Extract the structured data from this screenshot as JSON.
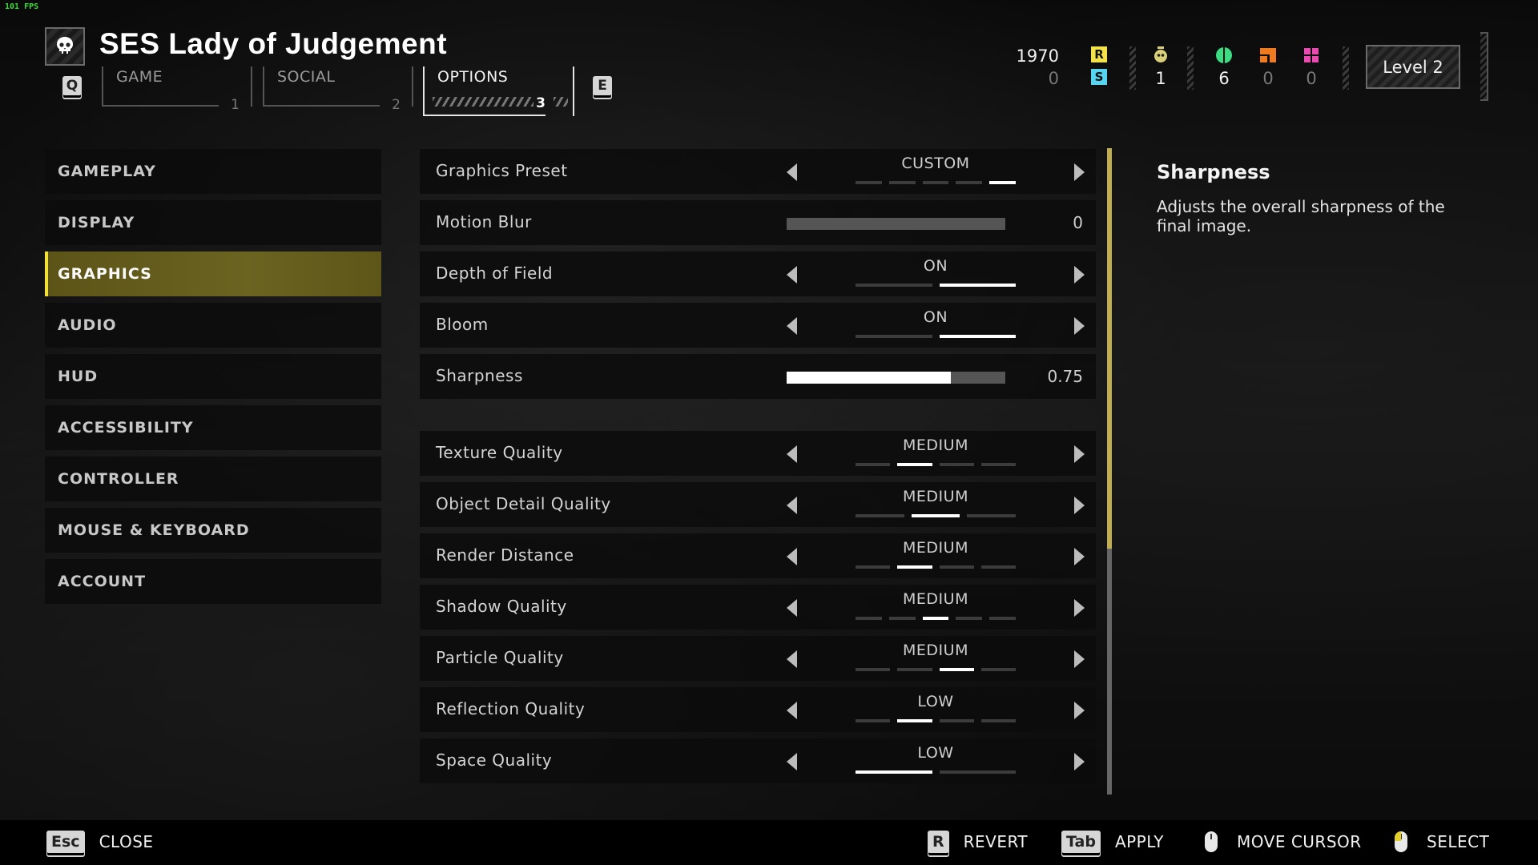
{
  "fps": "101 FPS",
  "header": {
    "title": "SES Lady of Judgement",
    "prev_key": "Q",
    "next_key": "E",
    "tabs": [
      {
        "label": "GAME",
        "number": "1",
        "active": false
      },
      {
        "label": "SOCIAL",
        "number": "2",
        "active": false
      },
      {
        "label": "OPTIONS",
        "number": "3",
        "active": true
      }
    ]
  },
  "currencies": {
    "requisition": {
      "value": "1970",
      "icon": "R",
      "color": "#f4e24a"
    },
    "super_credits": {
      "value": "0",
      "icon": "S",
      "color": "#56d4f0"
    }
  },
  "stats": [
    {
      "name": "medals",
      "value": "1",
      "color": "#d9cf7a"
    },
    {
      "name": "common-samples",
      "value": "6",
      "color": "#3ddc84"
    },
    {
      "name": "rare-samples",
      "value": "0",
      "color": "#f07a1e"
    },
    {
      "name": "super-samples",
      "value": "0",
      "color": "#e84ab0"
    }
  ],
  "level": "Level 2",
  "sidebar": {
    "items": [
      {
        "label": "GAMEPLAY",
        "active": false
      },
      {
        "label": "DISPLAY",
        "active": false
      },
      {
        "label": "GRAPHICS",
        "active": true
      },
      {
        "label": "AUDIO",
        "active": false
      },
      {
        "label": "HUD",
        "active": false
      },
      {
        "label": "ACCESSIBILITY",
        "active": false
      },
      {
        "label": "CONTROLLER",
        "active": false
      },
      {
        "label": "MOUSE & KEYBOARD",
        "active": false
      },
      {
        "label": "ACCOUNT",
        "active": false
      }
    ]
  },
  "settings": [
    {
      "label": "Graphics Preset",
      "type": "selector",
      "value": "CUSTOM",
      "steps": 5,
      "selected_index": 4,
      "selected_span": 1
    },
    {
      "label": "Motion Blur",
      "type": "slider",
      "value": "0",
      "fraction": 0
    },
    {
      "label": "Depth of Field",
      "type": "selector",
      "value": "ON",
      "steps": 2,
      "selected_index": 1,
      "selected_span": 1
    },
    {
      "label": "Bloom",
      "type": "selector",
      "value": "ON",
      "steps": 2,
      "selected_index": 1,
      "selected_span": 1
    },
    {
      "label": "Sharpness",
      "type": "slider",
      "value": "0.75",
      "fraction": 0.75
    },
    {
      "label": "Texture Quality",
      "type": "selector",
      "value": "MEDIUM",
      "steps": 4,
      "selected_index": 1,
      "selected_span": 1
    },
    {
      "label": "Object Detail Quality",
      "type": "selector",
      "value": "MEDIUM",
      "steps": 3,
      "selected_index": 1,
      "selected_span": 1
    },
    {
      "label": "Render Distance",
      "type": "selector",
      "value": "MEDIUM",
      "steps": 4,
      "selected_index": 1,
      "selected_span": 1
    },
    {
      "label": "Shadow Quality",
      "type": "selector",
      "value": "MEDIUM",
      "steps": 5,
      "selected_index": 2,
      "selected_span": 1
    },
    {
      "label": "Particle Quality",
      "type": "selector",
      "value": "MEDIUM",
      "steps": 4,
      "selected_index": 2,
      "selected_span": 1
    },
    {
      "label": "Reflection Quality",
      "type": "selector",
      "value": "LOW",
      "steps": 4,
      "selected_index": 1,
      "selected_span": 1
    },
    {
      "label": "Space Quality",
      "type": "selector",
      "value": "LOW",
      "steps": 2,
      "selected_index": 0,
      "selected_span": 1
    }
  ],
  "scroll": {
    "thumb_fraction": 0.62,
    "position": 0
  },
  "description": {
    "title": "Sharpness",
    "body": "Adjusts the overall sharpness of the final image."
  },
  "footer": {
    "close": {
      "key": "Esc",
      "label": "CLOSE"
    },
    "revert": {
      "key": "R",
      "label": "REVERT"
    },
    "apply": {
      "key": "Tab",
      "label": "APPLY"
    },
    "move_cursor": {
      "icon": "mouse-icon",
      "label": "MOVE CURSOR"
    },
    "select": {
      "icon": "mouse-left-click-icon",
      "label": "SELECT"
    }
  }
}
